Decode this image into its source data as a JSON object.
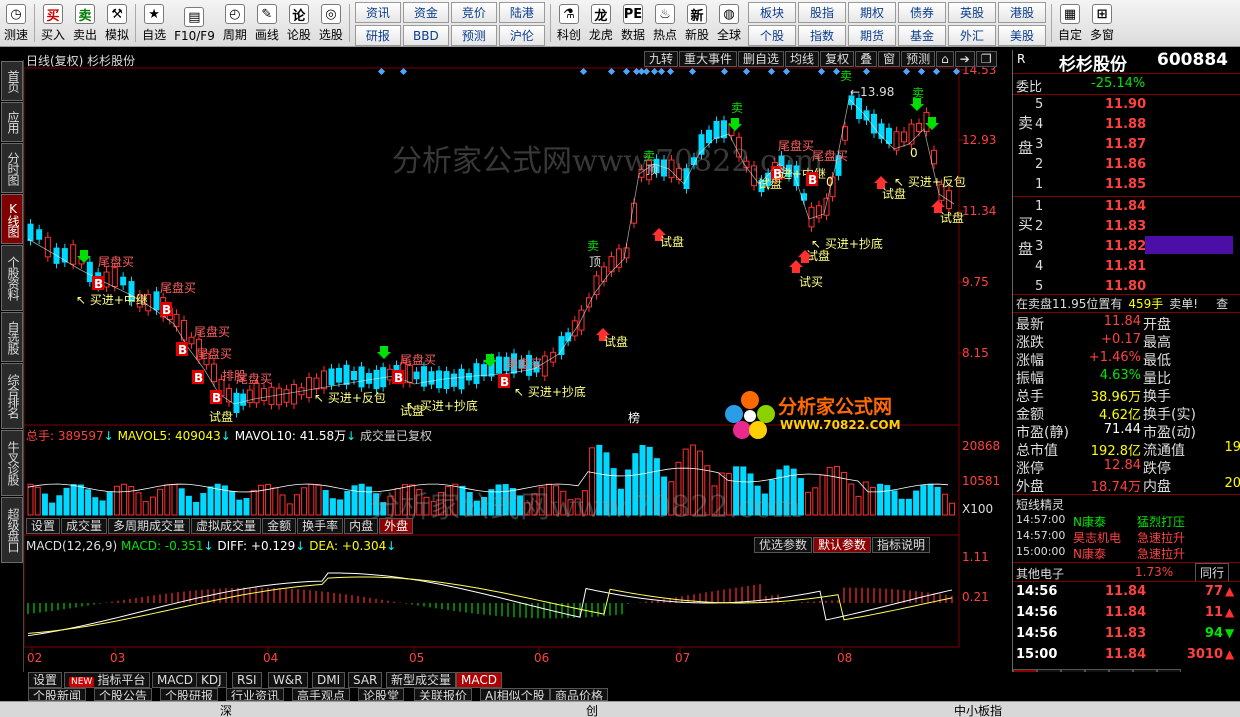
{
  "toolbar": {
    "left": [
      {
        "name": "clock-icon",
        "label": "测速",
        "glyph": "◷"
      },
      {
        "name": "buy-icon",
        "label": "买入",
        "glyph": "买",
        "color": "#d00000"
      },
      {
        "name": "sell-icon",
        "label": "卖出",
        "glyph": "卖",
        "color": "#007a00"
      },
      {
        "name": "hammer-icon",
        "label": "模拟",
        "glyph": "⚒"
      },
      {
        "name": "star-icon",
        "label": "自选",
        "glyph": "★"
      },
      {
        "name": "f10-icon",
        "label": "F10/F9",
        "glyph": "▤"
      },
      {
        "name": "cycle-icon",
        "label": "周期",
        "glyph": "◴"
      },
      {
        "name": "pen-icon",
        "label": "画线",
        "glyph": "✎"
      },
      {
        "name": "stock-icon",
        "label": "论股",
        "glyph": "论"
      },
      {
        "name": "target-icon",
        "label": "选股",
        "glyph": "◎"
      }
    ],
    "grid1": [
      "资讯",
      "资金",
      "竞价",
      "陆港",
      "研报",
      "BBD",
      "预测",
      "沪伦"
    ],
    "mid": [
      {
        "name": "science-icon",
        "label": "科创",
        "glyph": "⚗"
      },
      {
        "name": "dragon-icon",
        "label": "龙虎",
        "glyph": "龙"
      },
      {
        "name": "data-icon",
        "label": "数据",
        "glyph": "PE"
      },
      {
        "name": "fire-icon",
        "label": "热点",
        "glyph": "♨"
      },
      {
        "name": "news-icon",
        "label": "新股",
        "glyph": "新"
      },
      {
        "name": "globe-icon",
        "label": "全球",
        "glyph": "◍"
      }
    ],
    "grid2": [
      "板块",
      "股指",
      "期权",
      "债券",
      "英股",
      "港股",
      "个股",
      "指数",
      "期货",
      "基金",
      "外汇",
      "美股"
    ],
    "right": [
      {
        "name": "custom-icon",
        "label": "自定",
        "glyph": "▦"
      },
      {
        "name": "multi-icon",
        "label": "多窗",
        "glyph": "⊞"
      }
    ]
  },
  "left_tabs": [
    "首页",
    "应用",
    "分时图",
    "K线图",
    "个股资料",
    "自选股",
    "综合排名",
    "牛叉诊股",
    "超级盘口"
  ],
  "chart": {
    "title": "日线(复权) 杉杉股份",
    "watermark": "分析家公式网www.70822.com",
    "top_buttons": [
      "九转",
      "重大事件",
      "删自选",
      "均线",
      "复权",
      "叠",
      "窗",
      "预测"
    ],
    "price_axis": [
      "14.53",
      "12.93",
      "11.34",
      "9.75",
      "8.15"
    ],
    "high_label": "13.98",
    "vol_header": {
      "a": "总手: 389597",
      "b": "MAVOL5: 409043",
      "c": "MAVOL10: 41.58万",
      "d": "成交量已复权"
    },
    "vol_axis": [
      "20868",
      "10581",
      "X100"
    ],
    "vol_buttons": [
      "设置",
      "成交量",
      "多周期成交量",
      "虚拟成交量",
      "金额",
      "换手率",
      "内盘",
      "外盘"
    ],
    "macd_header": {
      "a": "MACD(12,26,9)",
      "b": "MACD: -0.351",
      "c": "DIFF: +0.129",
      "d": "DEA: +0.304"
    },
    "macd_buttons": [
      "优选参数",
      "默认参数",
      "指标说明"
    ],
    "macd_axis": [
      "1.11",
      "0.21"
    ],
    "months": [
      "02",
      "03",
      "04",
      "05",
      "06",
      "07",
      "08"
    ],
    "logo": {
      "name": "分析家公式网",
      "url": "WWW.70822.COM"
    },
    "signals": {
      "weipan": "尾盘买",
      "shipan": "试盘",
      "maijin_zhongxian": "买进+中继",
      "maijin_fanbao": "买进+反包",
      "maijin_chaodi": "买进+抄底",
      "sell": "卖",
      "top": "顶",
      "sell_label": "试买",
      "paigu": "排股",
      "bang": "榜"
    }
  },
  "quote": {
    "name": "杉杉股份",
    "code": "600884",
    "r": "R",
    "weibi_label": "委比",
    "weibi": "-25.14%",
    "sell_label": "卖盘",
    "buy_label": "买盘",
    "sells": [
      {
        "n": "5",
        "p": "11.90"
      },
      {
        "n": "4",
        "p": "11.88"
      },
      {
        "n": "3",
        "p": "11.87"
      },
      {
        "n": "2",
        "p": "11.86"
      },
      {
        "n": "1",
        "p": "11.85"
      }
    ],
    "buys": [
      {
        "n": "1",
        "p": "11.84"
      },
      {
        "n": "2",
        "p": "11.83"
      },
      {
        "n": "3",
        "p": "11.82"
      },
      {
        "n": "4",
        "p": "11.81"
      },
      {
        "n": "5",
        "p": "11.80"
      }
    ],
    "notice": {
      "a": "在卖盘11.95位置有",
      "b": "459手",
      "c": "卖单!",
      "d": "查"
    },
    "stats": [
      {
        "k": "最新",
        "v": "11.84",
        "c": "red",
        "k2": "开盘",
        "v2": ""
      },
      {
        "k": "涨跌",
        "v": "+0.17",
        "c": "red",
        "k2": "最高",
        "v2": ""
      },
      {
        "k": "涨幅",
        "v": "+1.46%",
        "c": "red",
        "k2": "最低",
        "v2": ""
      },
      {
        "k": "振幅",
        "v": "4.63%",
        "c": "green",
        "k2": "量比",
        "v2": ""
      },
      {
        "k": "总手",
        "v": "38.96万",
        "c": "yellow",
        "k2": "换手",
        "v2": ""
      },
      {
        "k": "金额",
        "v": "4.62亿",
        "c": "yellow",
        "k2": "换手(实)",
        "v2": ""
      },
      {
        "k": "市盈(静)",
        "v": "71.44",
        "c": "white",
        "k2": "市盈(动)",
        "v2": ""
      },
      {
        "k": "总市值",
        "v": "192.8亿",
        "c": "yellow",
        "k2": "流通值",
        "v2": "19"
      },
      {
        "k": "涨停",
        "v": "12.84",
        "c": "red",
        "k2": "跌停",
        "v2": ""
      },
      {
        "k": "外盘",
        "v": "18.74万",
        "c": "red",
        "k2": "内盘",
        "v2": "20"
      }
    ],
    "jingling_title": "短线精灵",
    "jingling": [
      {
        "t": "14:57:00",
        "s": "N康泰",
        "a": "猛烈打压",
        "c": "green"
      },
      {
        "t": "14:57:00",
        "s": "昊志机电",
        "a": "急速拉升",
        "c": "red"
      },
      {
        "t": "15:00:00",
        "s": "N康泰",
        "a": "急速拉升",
        "c": "red"
      }
    ],
    "sector": {
      "name": "其他电子",
      "pct": "1.73%",
      "btn": "同行"
    },
    "ticks": [
      {
        "t": "14:56",
        "p": "11.84",
        "v": "77",
        "d": "up"
      },
      {
        "t": "14:56",
        "p": "11.84",
        "v": "11",
        "d": "up"
      },
      {
        "t": "14:56",
        "p": "11.83",
        "v": "94",
        "d": "down"
      },
      {
        "t": "15:00",
        "p": "11.84",
        "v": "3010",
        "d": "up"
      }
    ],
    "bottom_tabs": [
      "细",
      "诊",
      "分",
      "筹",
      "竞",
      "指",
      "财"
    ]
  },
  "bottom": {
    "tabs1": [
      "设置",
      "指标平台",
      "MACD",
      "KDJ",
      "RSI",
      "W&R",
      "DMI",
      "SAR",
      "新型成交量",
      "MACD"
    ],
    "new_badge": "NEW",
    "tabs2": [
      "个股新闻",
      "个股公告",
      "个股研报",
      "行业资讯",
      "高手观点",
      "论股堂",
      "关联报价",
      "AI相似个股",
      "商品价格"
    ],
    "status": {
      "a": "深",
      "b": "创",
      "c": "中小板指"
    }
  }
}
